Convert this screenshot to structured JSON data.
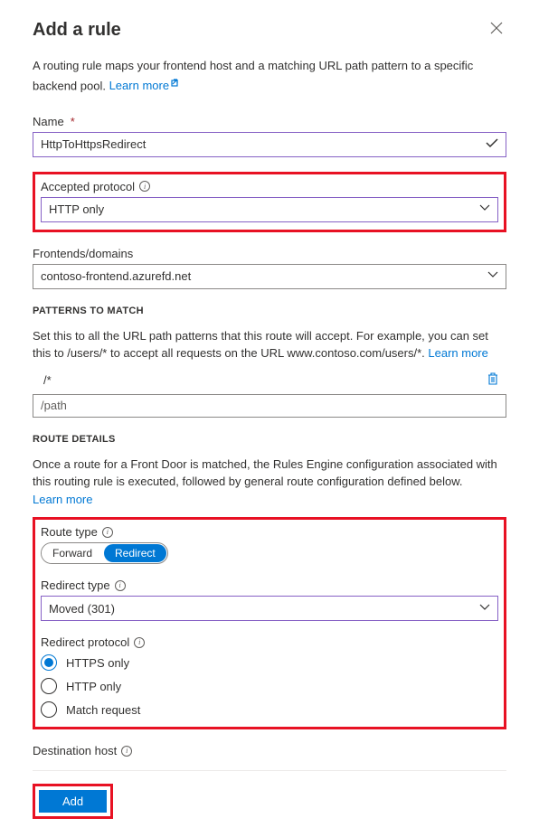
{
  "header": {
    "title": "Add a rule"
  },
  "intro": {
    "text": "A routing rule maps your frontend host and a matching URL path pattern to a specific backend pool. ",
    "link": "Learn more"
  },
  "name": {
    "label": "Name",
    "value": "HttpToHttpsRedirect"
  },
  "protocol": {
    "label": "Accepted protocol",
    "value": "HTTP only"
  },
  "frontends": {
    "label": "Frontends/domains",
    "value": "contoso-frontend.azurefd.net"
  },
  "patterns": {
    "title": "PATTERNS TO MATCH",
    "help": "Set this to all the URL path patterns that this route will accept. For example, you can set this to /users/* to accept all requests on the URL www.contoso.com/users/*. ",
    "link": "Learn more",
    "existing": "/*",
    "placeholder": "/path"
  },
  "route": {
    "title": "ROUTE DETAILS",
    "help": "Once a route for a Front Door is matched, the Rules Engine configuration associated with this routing rule is executed, followed by general route configuration defined below.",
    "link": "Learn more",
    "type_label": "Route type",
    "forward": "Forward",
    "redirect": "Redirect",
    "redirect_type_label": "Redirect type",
    "redirect_type_value": "Moved (301)",
    "redirect_protocol_label": "Redirect protocol",
    "proto_https": "HTTPS only",
    "proto_http": "HTTP only",
    "proto_match": "Match request"
  },
  "dest": {
    "label": "Destination host"
  },
  "footer": {
    "add": "Add"
  }
}
